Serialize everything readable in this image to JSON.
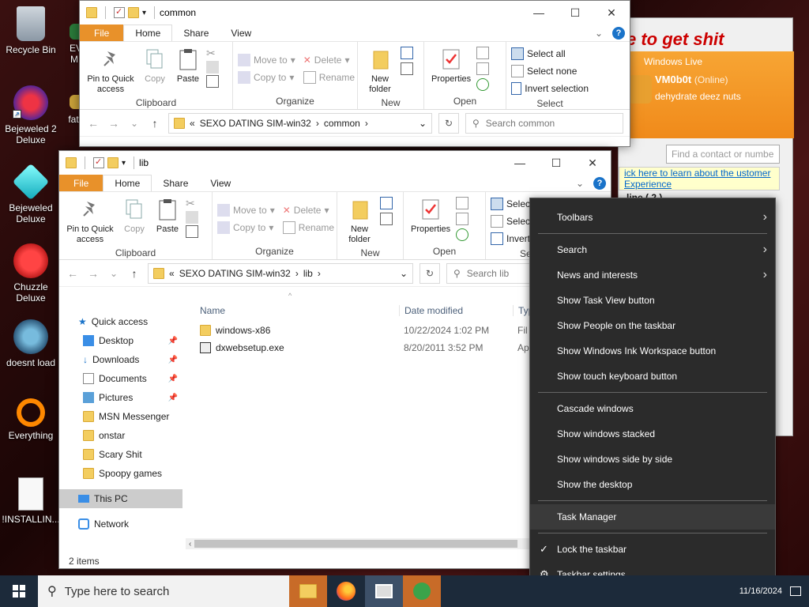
{
  "desktop": {
    "icons": [
      {
        "label": "Recycle Bin"
      },
      {
        "label": "EV M"
      },
      {
        "label": "Bejeweled 2 Deluxe"
      },
      {
        "label": "fat l"
      },
      {
        "label": "Bejeweled Deluxe"
      },
      {
        "label": "Chuzzle Deluxe"
      },
      {
        "label": "doesnt load"
      },
      {
        "label": "Everything"
      },
      {
        "label": "!INSTALLIN..."
      }
    ]
  },
  "window_common": {
    "title": "common",
    "tabs": [
      "File",
      "Home",
      "Share",
      "View"
    ],
    "clipboard": {
      "pin": "Pin to Quick access",
      "copy": "Copy",
      "paste": "Paste",
      "group": "Clipboard"
    },
    "organize": {
      "move": "Move to",
      "copy": "Copy to",
      "delete": "Delete",
      "rename": "Rename",
      "group": "Organize"
    },
    "new": {
      "folder": "New folder",
      "group": "New"
    },
    "open": {
      "properties": "Properties",
      "group": "Open"
    },
    "select": {
      "all": "Select all",
      "none": "Select none",
      "invert": "Invert selection",
      "group": "Select"
    },
    "address": {
      "prefix": "«",
      "parts": [
        "SEXO DATING SIM-win32",
        "common"
      ]
    },
    "search_placeholder": "Search common"
  },
  "window_lib": {
    "title": "lib",
    "tabs": [
      "File",
      "Home",
      "Share",
      "View"
    ],
    "clipboard": {
      "pin": "Pin to Quick access",
      "copy": "Copy",
      "paste": "Paste",
      "group": "Clipboard"
    },
    "organize": {
      "move": "Move to",
      "copy": "Copy to",
      "delete": "Delete",
      "rename": "Rename",
      "group": "Organize"
    },
    "new": {
      "folder": "New folder",
      "group": "New"
    },
    "open": {
      "properties": "Properties",
      "group": "Open"
    },
    "select": {
      "all": "Select a",
      "none": "Select n",
      "invert": "Invert s",
      "group": "Sele"
    },
    "address": {
      "prefix": "«",
      "parts": [
        "SEXO DATING SIM-win32",
        "lib"
      ]
    },
    "search_placeholder": "Search lib",
    "nav": {
      "quick_access": "Quick access",
      "items": [
        "Desktop",
        "Downloads",
        "Documents",
        "Pictures",
        "MSN Messenger",
        "onstar",
        "Scary Shit",
        "Spoopy games"
      ],
      "this_pc": "This PC",
      "network": "Network"
    },
    "columns": {
      "name": "Name",
      "date": "Date modified",
      "type": "Typ"
    },
    "files": [
      {
        "name": "windows-x86",
        "date": "10/22/2024 1:02 PM",
        "type": "Fil"
      },
      {
        "name": "dxwebsetup.exe",
        "date": "8/20/2011 3:52 PM",
        "type": "Ap"
      }
    ],
    "status": "2 items"
  },
  "msn": {
    "title": "Windows Live",
    "user": "VM0b0t",
    "status": "(Online)",
    "message": "dehydrate deez nuts",
    "search_placeholder": "Find a contact or numbe",
    "banner": "ick here to learn about the ustomer Experience",
    "online": "line ( 2 )",
    "bg_text": "e to get shit"
  },
  "context_menu": {
    "toolbars": "Toolbars",
    "search": "Search",
    "news": "News and interests",
    "task_view": "Show Task View button",
    "people": "Show People on the taskbar",
    "ink": "Show Windows Ink Workspace button",
    "touch": "Show touch keyboard button",
    "cascade": "Cascade windows",
    "stacked": "Show windows stacked",
    "side": "Show windows side by side",
    "desktop": "Show the desktop",
    "task_manager": "Task Manager",
    "lock": "Lock the taskbar",
    "settings": "Taskbar settings"
  },
  "taskbar": {
    "search_placeholder": "Type here to search",
    "date": "11/16/2024"
  },
  "colors": {
    "file_tab": "#e8912a",
    "accent": "#1a73c9",
    "msn_orange": "#f39a24"
  }
}
